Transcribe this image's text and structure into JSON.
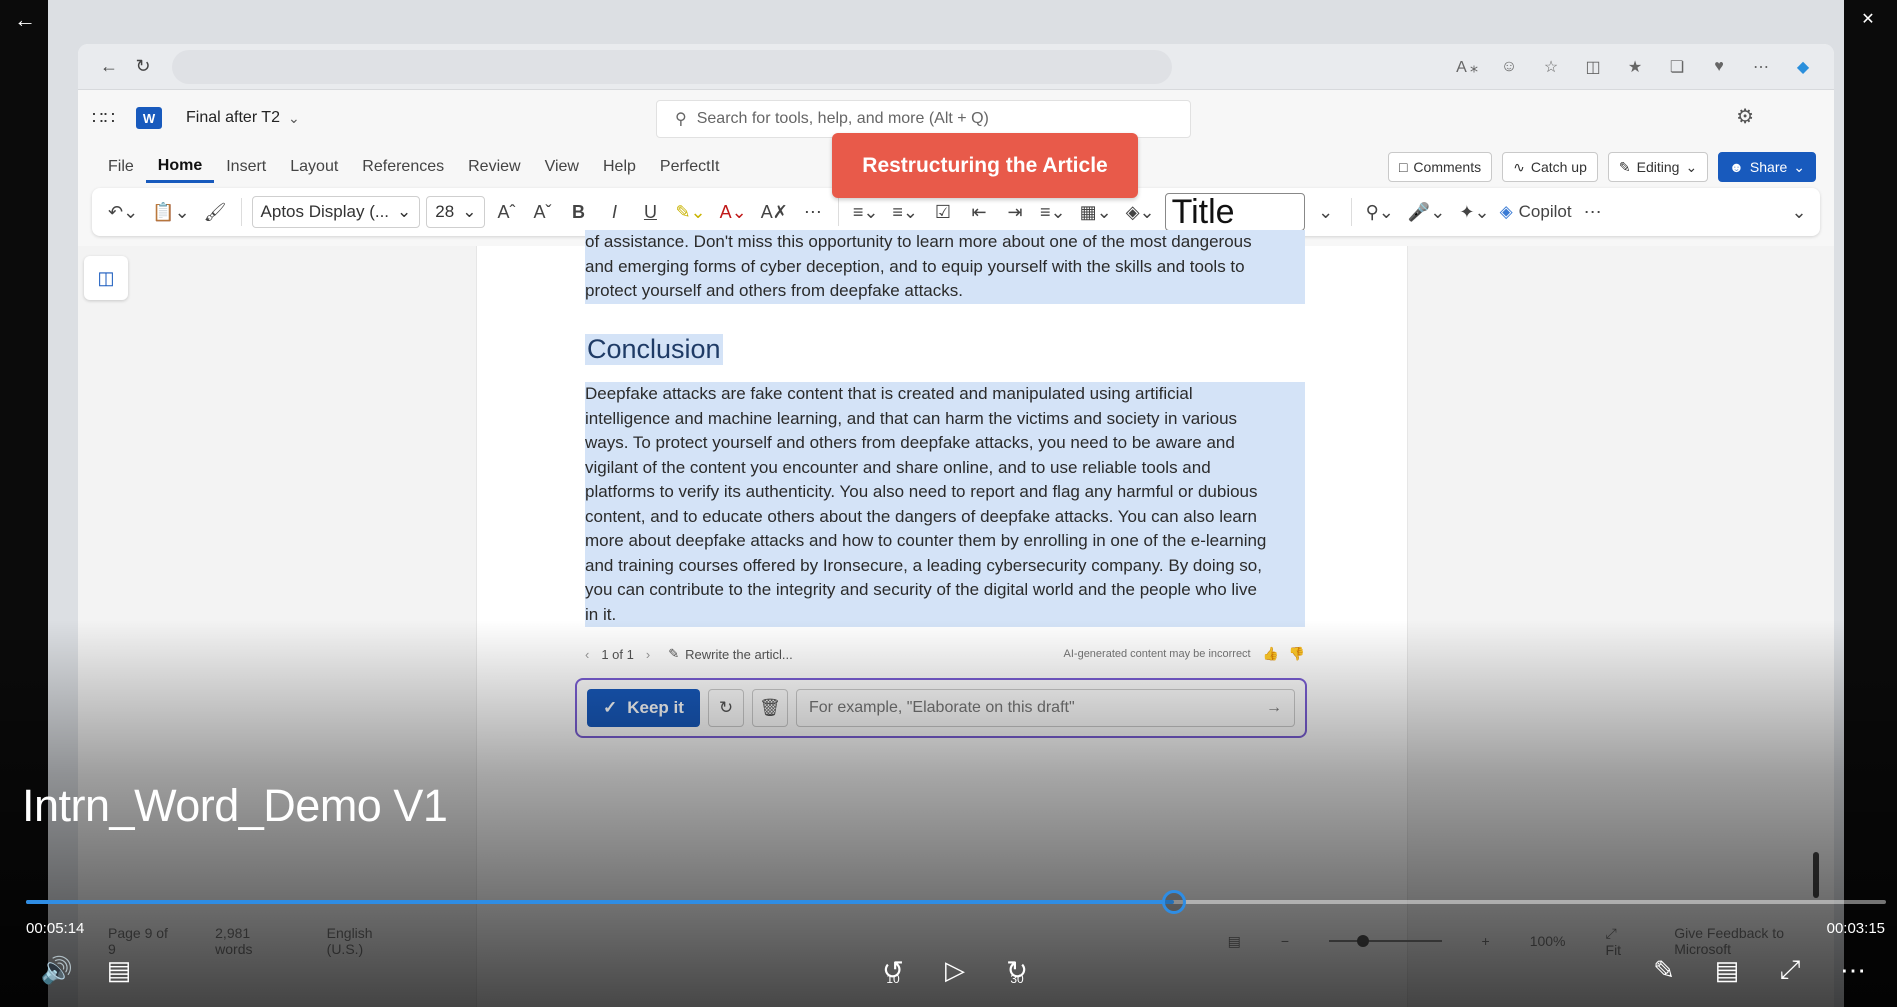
{
  "document_page": {
    "partial_paragraph": [
      "of assistance. Don't miss this opportunity to learn more about one of the most dangerous",
      "and emerging forms of cyber deception, and to equip yourself with the skills and tools to",
      "protect yourself and others from deepfake attacks."
    ],
    "heading": "Conclusion",
    "conclusion_lines": [
      "Deepfake attacks are fake content that is created and manipulated using artificial",
      "intelligence and machine learning, and that can harm the victims and society in various",
      "ways. To protect yourself and others from deepfake attacks, you need to be aware and",
      "vigilant of the content you encounter and share online, and to use reliable tools and",
      "platforms to verify its authenticity. You also need to report and flag any harmful or dubious",
      "content, and to educate others about the dangers of deepfake attacks. You can also learn",
      "more about deepfake attacks and how to counter them by enrolling in one of the e-learning",
      "and training courses offered by Ironsecure, a leading cybersecurity company. By doing so,",
      "you can contribute to the integrity and security of the digital world and the people who live",
      "in it."
    ]
  },
  "word": {
    "doc_title": "Final after T2",
    "search_placeholder": "Search for tools, help, and more (Alt + Q)",
    "menu": [
      "File",
      "Home",
      "Insert",
      "Layout",
      "References",
      "Review",
      "View",
      "Help",
      "PerfectIt"
    ],
    "comments": "Comments",
    "catch_up": "Catch up",
    "editing": "Editing",
    "share": "Share",
    "font_name": "Aptos Display (...",
    "font_size": "28",
    "style_name": "Title",
    "copilot": "Copilot"
  },
  "ai_panel": {
    "counter": "1 of 1",
    "rewrite": "Rewrite the articl...",
    "disclaimer": "AI-generated content may be incorrect",
    "keep": "Keep it",
    "prompt_placeholder": "For example, \"Elaborate on this draft\""
  },
  "callout": "Restructuring the Article",
  "statusbar": {
    "page": "Page 9 of 9",
    "words": "2,981 words",
    "language": "English (U.S.)",
    "zoom": "100%",
    "fit": "Fit",
    "feedback": "Give Feedback to Microsoft"
  },
  "player": {
    "video_title": "Intrn_Word_Demo V1",
    "elapsed": "00:05:14",
    "remaining": "00:03:15",
    "progress_fraction": 0.617,
    "skip_back": "10",
    "skip_forward": "30"
  }
}
